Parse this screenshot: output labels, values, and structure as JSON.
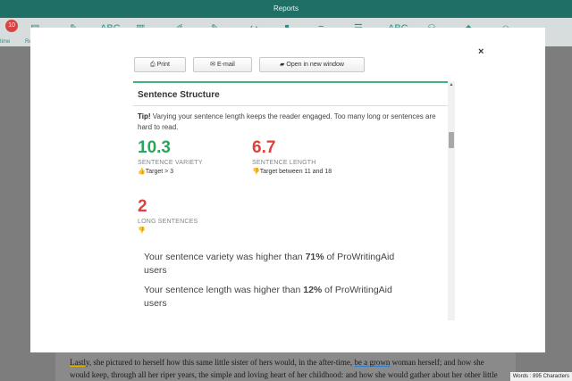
{
  "app": {
    "title": "Reports",
    "notification_count": "10"
  },
  "ribbon": {
    "label_left": "time",
    "label_second": "Re"
  },
  "modal": {
    "buttons": [
      {
        "label": "Print",
        "icon": "printer-icon"
      },
      {
        "label": "E-mail",
        "icon": "envelope-icon"
      },
      {
        "label": "Open in new window",
        "icon": "folder-open-icon"
      }
    ],
    "close_symbol": "×"
  },
  "report": {
    "section_title": "Sentence Structure",
    "tip_label": "Tip!",
    "tip_text": "Varying your sentence length keeps the reader engaged. Too many long or sentences are hard to read.",
    "metrics": {
      "variety": {
        "value": "10.3",
        "label": "SENTENCE VARIETY",
        "target": "Target > 3",
        "status": "good",
        "color": "#2aa75a"
      },
      "length": {
        "value": "6.7",
        "label": "SENTENCE LENGTH",
        "target": "Target between 11 and 18",
        "status": "bad",
        "color": "#e0403a"
      },
      "long": {
        "value": "2",
        "label": "LONG SENTENCES",
        "status": "bad",
        "color": "#e0403a"
      }
    },
    "comparison": {
      "variety_prefix": "Your sentence variety was higher than ",
      "variety_pct": "71%",
      "variety_suffix": " of ProWritingAid users",
      "length_prefix": "Your sentence length was higher than ",
      "length_pct": "12%",
      "length_suffix": " of ProWritingAid users"
    }
  },
  "document": {
    "line1_a": "Lastly",
    "line1_b": ", she pictured to herself how this same little sister of hers would, in the after-time, ",
    "line1_c": "be a grown",
    "line1_d": " woman herself; and how she",
    "line2": "would keep, through all her riper years, the simple and loving heart of her childhood: and how she would gather about her other little"
  },
  "status": {
    "words": "Words : 895 Characters"
  }
}
